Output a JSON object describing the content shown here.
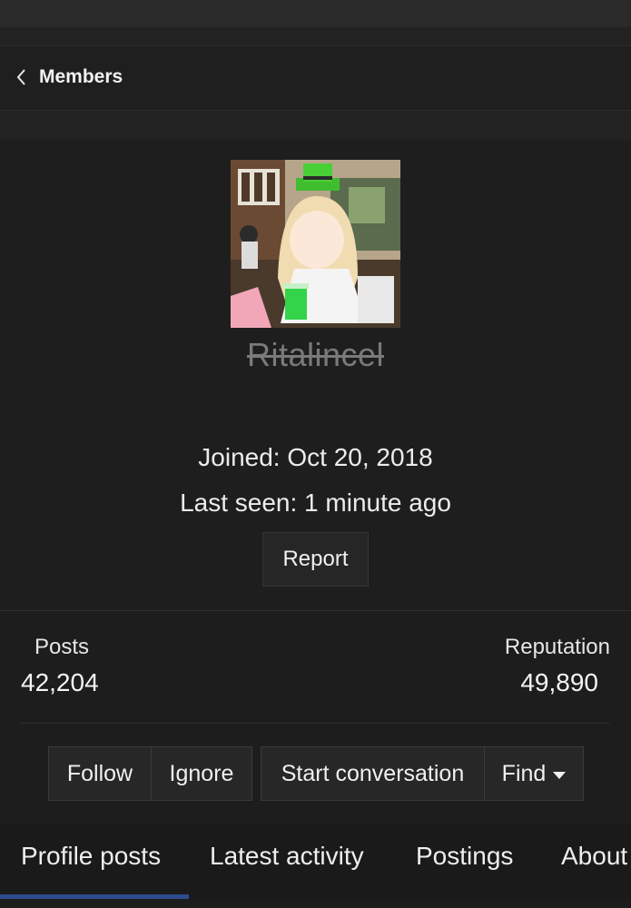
{
  "nav": {
    "back_label": "Members"
  },
  "profile": {
    "username": "Ritalincel",
    "joined": "Joined: Oct 20, 2018",
    "last_seen": "Last seen: 1 minute ago",
    "report_label": "Report"
  },
  "stats": {
    "posts_label": "Posts",
    "posts_value": "42,204",
    "reputation_label": "Reputation",
    "reputation_value": "49,890"
  },
  "actions": {
    "follow": "Follow",
    "ignore": "Ignore",
    "start_conversation": "Start conversation",
    "find": "Find"
  },
  "tabs": [
    "Profile posts",
    "Latest activity",
    "Postings",
    "About"
  ],
  "colors": {
    "background": "#1e1e1e",
    "active_tab_underline": "#2e4b8f",
    "username_strike": "#7a7a7a"
  }
}
